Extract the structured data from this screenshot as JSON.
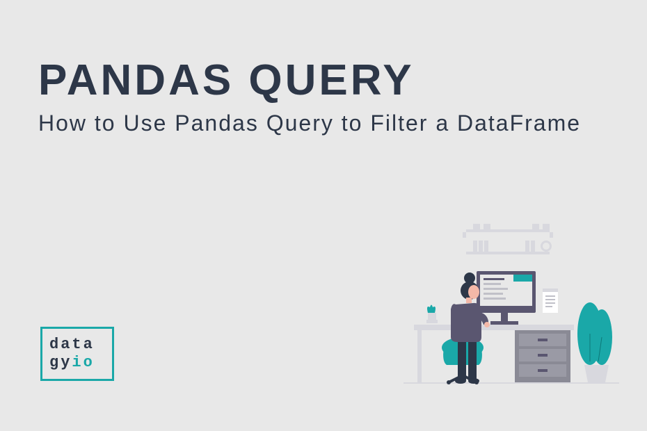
{
  "title": "PANDAS QUERY",
  "subtitle": "How to Use Pandas Query to Filter a DataFrame",
  "logo": {
    "line1_gray": "data",
    "line2_gray": "gy",
    "line2_accent": "io"
  },
  "colors": {
    "background": "#e8e8e8",
    "text_dark": "#2d3748",
    "accent_teal": "#1aa8a8",
    "skin": "#f4b8a8",
    "purple_gray": "#5a5670",
    "drawer_gray": "#8a8a95",
    "light_gray": "#d8d8de"
  }
}
